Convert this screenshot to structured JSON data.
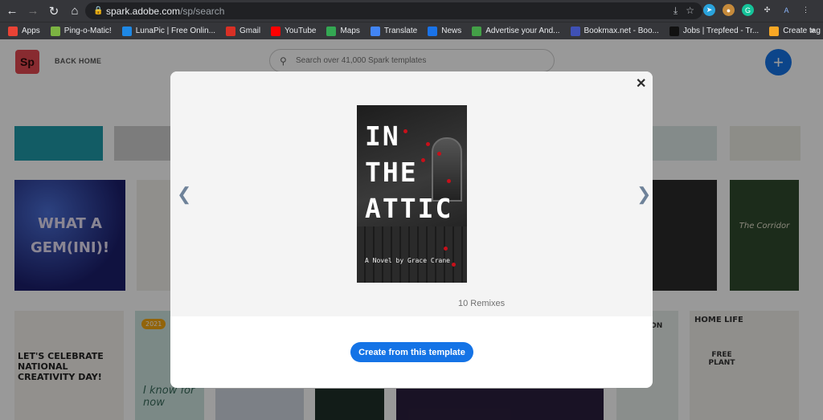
{
  "browser": {
    "url_host": "spark.adobe.com",
    "url_path": "/sp/search",
    "bookmarks": [
      {
        "label": "Apps",
        "color": "#ea4335"
      },
      {
        "label": "Ping-o-Matic!",
        "color": "#7cb342"
      },
      {
        "label": "LunaPic | Free Onlin...",
        "color": "#1e88e5"
      },
      {
        "label": "Gmail",
        "color": "#d93025"
      },
      {
        "label": "YouTube",
        "color": "#ff0000"
      },
      {
        "label": "Maps",
        "color": "#34a853"
      },
      {
        "label": "Translate",
        "color": "#4285f4"
      },
      {
        "label": "News",
        "color": "#1a73e8"
      },
      {
        "label": "Advertise your And...",
        "color": "#43a047"
      },
      {
        "label": "Bookmax.net - Boo...",
        "color": "#3f51b5"
      },
      {
        "label": "Jobs | Trepfeed - Tr...",
        "color": "#111111"
      },
      {
        "label": "Create tag | Propell...",
        "color": "#f9a825"
      }
    ],
    "bookmarks_more": "»"
  },
  "header": {
    "logo_text": "Sp",
    "back_home": "BACK HOME",
    "search_placeholder": "Search over 41,000 Spark templates",
    "plus_label": "+"
  },
  "tiles": {
    "gemini_text": "WHAT A GEM(INI)!",
    "celebrate_text": "LET'S CELEBRATE NATIONAL CREATIVITY DAY!",
    "year_text": "2021",
    "know_text": "I know for now",
    "homelife_title": "HOME LIFE",
    "freeplant_text": "FREE PLANT",
    "corridor_text": "The Corridor",
    "season_text": "SEASON BAGS"
  },
  "modal": {
    "close": "✕",
    "prev": "❮",
    "next": "❯",
    "cover_title": [
      "IN",
      "THE",
      "ATTIC"
    ],
    "cover_author": "A Novel by Grace Crane",
    "remixes": "10 Remixes",
    "cta": "Create from this template"
  }
}
